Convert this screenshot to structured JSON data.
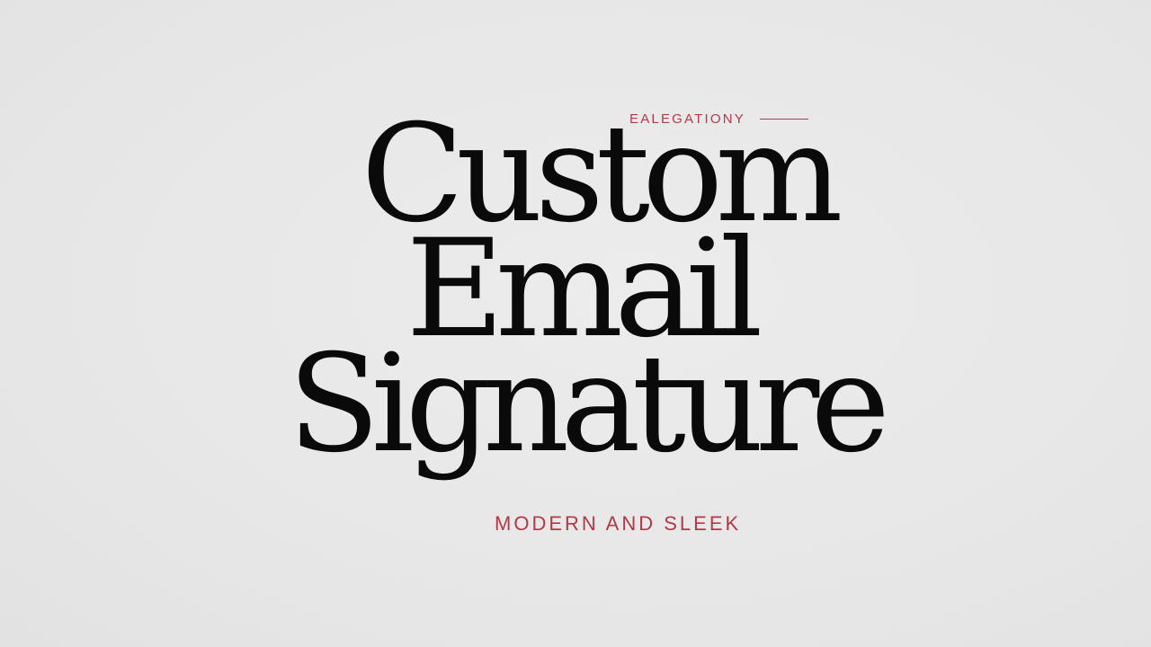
{
  "eyebrow": {
    "text": "EALEGATIONY"
  },
  "headline": {
    "line1": "Custom",
    "line2": "Email",
    "line3": "Signature"
  },
  "tagline": {
    "text": "MODERN AND SLEEK"
  },
  "colors": {
    "background": "#e8e8e8",
    "headline": "#0a0a0a",
    "accent": "#b23a48"
  }
}
